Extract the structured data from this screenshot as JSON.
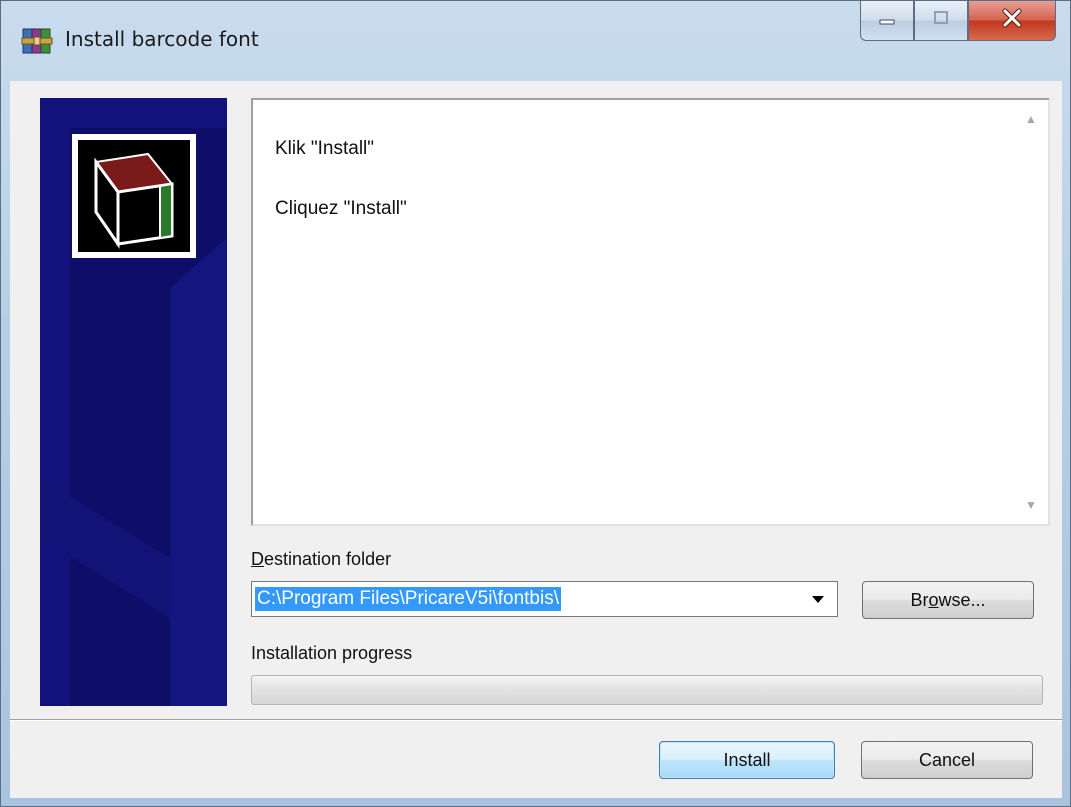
{
  "window": {
    "title": "Install barcode font"
  },
  "message": {
    "lines": [
      "Klik \"Install\"",
      "Cliquez \"Install\""
    ]
  },
  "destination": {
    "label_accel": "D",
    "label_rest": "estination folder",
    "value": "C:\\Program Files\\PricareV5i\\fontbis\\"
  },
  "browse": {
    "label_pre": "Br",
    "label_accel": "o",
    "label_post": "wse..."
  },
  "progress": {
    "label": "Installation progress",
    "value": 0
  },
  "buttons": {
    "install": "Install",
    "cancel": "Cancel"
  },
  "colors": {
    "banner_bg": "#0b0b5a",
    "selection": "#3399ff"
  },
  "icons": {
    "title": "winrar-archive-icon",
    "banner_logo": "box-icon",
    "dropdown": "chevron-down-icon"
  }
}
